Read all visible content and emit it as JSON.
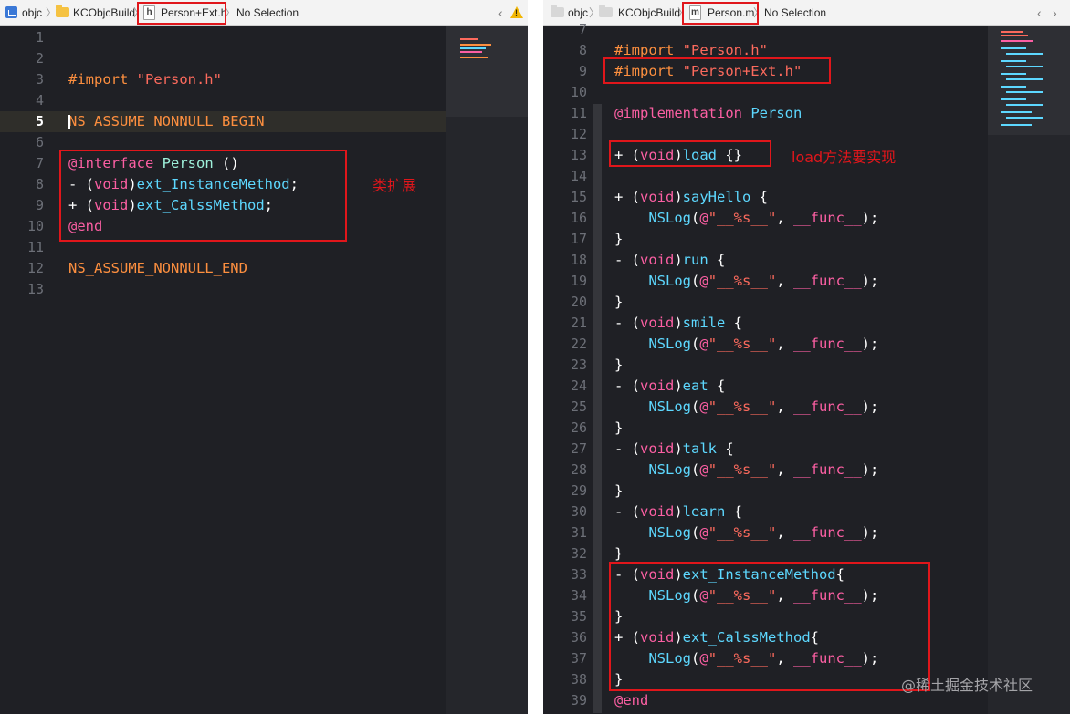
{
  "left_pane": {
    "breadcrumb": {
      "project": "objc",
      "group": "KCObjcBuild",
      "file_badge": "h",
      "file": "Person+Ext.h",
      "selection": "No Selection"
    },
    "current_line": 5,
    "lines": [
      {
        "n": "1",
        "tokens": []
      },
      {
        "n": "2",
        "tokens": []
      },
      {
        "n": "3",
        "tokens": [
          {
            "c": "t-pre",
            "t": "#import "
          },
          {
            "c": "t-str",
            "t": "\"Person.h\""
          }
        ]
      },
      {
        "n": "4",
        "tokens": []
      },
      {
        "n": "5",
        "tokens": [
          {
            "c": "t-macro",
            "t": "NS_ASSUME_NONNULL_BEGIN"
          }
        ]
      },
      {
        "n": "6",
        "tokens": []
      },
      {
        "n": "7",
        "tokens": [
          {
            "c": "t-kw",
            "t": "@interface "
          },
          {
            "c": "t-type",
            "t": "Person"
          },
          {
            "c": "t-pl",
            "t": " ()"
          }
        ]
      },
      {
        "n": "8",
        "tokens": [
          {
            "c": "t-pl",
            "t": "- ("
          },
          {
            "c": "t-kw",
            "t": "void"
          },
          {
            "c": "t-pl",
            "t": ")"
          },
          {
            "c": "t-cls",
            "t": "ext_InstanceMethod"
          },
          {
            "c": "t-pl",
            "t": ";"
          }
        ]
      },
      {
        "n": "9",
        "tokens": [
          {
            "c": "t-pl",
            "t": "+ ("
          },
          {
            "c": "t-kw",
            "t": "void"
          },
          {
            "c": "t-pl",
            "t": ")"
          },
          {
            "c": "t-cls",
            "t": "ext_CalssMethod"
          },
          {
            "c": "t-pl",
            "t": ";"
          }
        ]
      },
      {
        "n": "10",
        "tokens": [
          {
            "c": "t-kw",
            "t": "@end"
          }
        ]
      },
      {
        "n": "11",
        "tokens": []
      },
      {
        "n": "12",
        "tokens": [
          {
            "c": "t-macro",
            "t": "NS_ASSUME_NONNULL_END"
          }
        ]
      },
      {
        "n": "13",
        "tokens": []
      }
    ],
    "annotation": "类扩展"
  },
  "right_pane": {
    "breadcrumb": {
      "project": "objc",
      "group": "KCObjcBuild",
      "file_badge": "m",
      "file": "Person.m",
      "selection": "No Selection"
    },
    "lines": [
      {
        "n": "7",
        "tokens": []
      },
      {
        "n": "8",
        "tokens": [
          {
            "c": "t-pre",
            "t": "#import "
          },
          {
            "c": "t-str",
            "t": "\"Person.h\""
          }
        ]
      },
      {
        "n": "9",
        "tokens": [
          {
            "c": "t-pre",
            "t": "#import "
          },
          {
            "c": "t-str",
            "t": "\"Person+Ext.h\""
          }
        ]
      },
      {
        "n": "10",
        "tokens": []
      },
      {
        "n": "11",
        "tokens": [
          {
            "c": "t-kw",
            "t": "@implementation "
          },
          {
            "c": "t-cls",
            "t": "Person"
          }
        ]
      },
      {
        "n": "12",
        "tokens": []
      },
      {
        "n": "13",
        "tokens": [
          {
            "c": "t-pl",
            "t": "+ ("
          },
          {
            "c": "t-kw",
            "t": "void"
          },
          {
            "c": "t-pl",
            "t": ")"
          },
          {
            "c": "t-cls",
            "t": "load"
          },
          {
            "c": "t-pl",
            "t": " {}"
          }
        ]
      },
      {
        "n": "14",
        "tokens": []
      },
      {
        "n": "15",
        "tokens": [
          {
            "c": "t-pl",
            "t": "+ ("
          },
          {
            "c": "t-kw",
            "t": "void"
          },
          {
            "c": "t-pl",
            "t": ")"
          },
          {
            "c": "t-cls",
            "t": "sayHello"
          },
          {
            "c": "t-pl",
            "t": " {"
          }
        ]
      },
      {
        "n": "16",
        "tokens": [
          {
            "c": "t-pl",
            "t": "    "
          },
          {
            "c": "t-cls",
            "t": "NSLog"
          },
          {
            "c": "t-pl",
            "t": "("
          },
          {
            "c": "t-kw",
            "t": "@"
          },
          {
            "c": "t-str",
            "t": "\"__%s__\""
          },
          {
            "c": "t-pl",
            "t": ", "
          },
          {
            "c": "t-kw",
            "t": "__func__"
          },
          {
            "c": "t-pl",
            "t": ");"
          }
        ]
      },
      {
        "n": "17",
        "tokens": [
          {
            "c": "t-pl",
            "t": "}"
          }
        ]
      },
      {
        "n": "18",
        "tokens": [
          {
            "c": "t-pl",
            "t": "- ("
          },
          {
            "c": "t-kw",
            "t": "void"
          },
          {
            "c": "t-pl",
            "t": ")"
          },
          {
            "c": "t-cls",
            "t": "run"
          },
          {
            "c": "t-pl",
            "t": " {"
          }
        ]
      },
      {
        "n": "19",
        "tokens": [
          {
            "c": "t-pl",
            "t": "    "
          },
          {
            "c": "t-cls",
            "t": "NSLog"
          },
          {
            "c": "t-pl",
            "t": "("
          },
          {
            "c": "t-kw",
            "t": "@"
          },
          {
            "c": "t-str",
            "t": "\"__%s__\""
          },
          {
            "c": "t-pl",
            "t": ", "
          },
          {
            "c": "t-kw",
            "t": "__func__"
          },
          {
            "c": "t-pl",
            "t": ");"
          }
        ]
      },
      {
        "n": "20",
        "tokens": [
          {
            "c": "t-pl",
            "t": "}"
          }
        ]
      },
      {
        "n": "21",
        "tokens": [
          {
            "c": "t-pl",
            "t": "- ("
          },
          {
            "c": "t-kw",
            "t": "void"
          },
          {
            "c": "t-pl",
            "t": ")"
          },
          {
            "c": "t-cls",
            "t": "smile"
          },
          {
            "c": "t-pl",
            "t": " {"
          }
        ]
      },
      {
        "n": "22",
        "tokens": [
          {
            "c": "t-pl",
            "t": "    "
          },
          {
            "c": "t-cls",
            "t": "NSLog"
          },
          {
            "c": "t-pl",
            "t": "("
          },
          {
            "c": "t-kw",
            "t": "@"
          },
          {
            "c": "t-str",
            "t": "\"__%s__\""
          },
          {
            "c": "t-pl",
            "t": ", "
          },
          {
            "c": "t-kw",
            "t": "__func__"
          },
          {
            "c": "t-pl",
            "t": ");"
          }
        ]
      },
      {
        "n": "23",
        "tokens": [
          {
            "c": "t-pl",
            "t": "}"
          }
        ]
      },
      {
        "n": "24",
        "tokens": [
          {
            "c": "t-pl",
            "t": "- ("
          },
          {
            "c": "t-kw",
            "t": "void"
          },
          {
            "c": "t-pl",
            "t": ")"
          },
          {
            "c": "t-cls",
            "t": "eat"
          },
          {
            "c": "t-pl",
            "t": " {"
          }
        ]
      },
      {
        "n": "25",
        "tokens": [
          {
            "c": "t-pl",
            "t": "    "
          },
          {
            "c": "t-cls",
            "t": "NSLog"
          },
          {
            "c": "t-pl",
            "t": "("
          },
          {
            "c": "t-kw",
            "t": "@"
          },
          {
            "c": "t-str",
            "t": "\"__%s__\""
          },
          {
            "c": "t-pl",
            "t": ", "
          },
          {
            "c": "t-kw",
            "t": "__func__"
          },
          {
            "c": "t-pl",
            "t": ");"
          }
        ]
      },
      {
        "n": "26",
        "tokens": [
          {
            "c": "t-pl",
            "t": "}"
          }
        ]
      },
      {
        "n": "27",
        "tokens": [
          {
            "c": "t-pl",
            "t": "- ("
          },
          {
            "c": "t-kw",
            "t": "void"
          },
          {
            "c": "t-pl",
            "t": ")"
          },
          {
            "c": "t-cls",
            "t": "talk"
          },
          {
            "c": "t-pl",
            "t": " {"
          }
        ]
      },
      {
        "n": "28",
        "tokens": [
          {
            "c": "t-pl",
            "t": "    "
          },
          {
            "c": "t-cls",
            "t": "NSLog"
          },
          {
            "c": "t-pl",
            "t": "("
          },
          {
            "c": "t-kw",
            "t": "@"
          },
          {
            "c": "t-str",
            "t": "\"__%s__\""
          },
          {
            "c": "t-pl",
            "t": ", "
          },
          {
            "c": "t-kw",
            "t": "__func__"
          },
          {
            "c": "t-pl",
            "t": ");"
          }
        ]
      },
      {
        "n": "29",
        "tokens": [
          {
            "c": "t-pl",
            "t": "}"
          }
        ]
      },
      {
        "n": "30",
        "tokens": [
          {
            "c": "t-pl",
            "t": "- ("
          },
          {
            "c": "t-kw",
            "t": "void"
          },
          {
            "c": "t-pl",
            "t": ")"
          },
          {
            "c": "t-cls",
            "t": "learn"
          },
          {
            "c": "t-pl",
            "t": " {"
          }
        ]
      },
      {
        "n": "31",
        "tokens": [
          {
            "c": "t-pl",
            "t": "    "
          },
          {
            "c": "t-cls",
            "t": "NSLog"
          },
          {
            "c": "t-pl",
            "t": "("
          },
          {
            "c": "t-kw",
            "t": "@"
          },
          {
            "c": "t-str",
            "t": "\"__%s__\""
          },
          {
            "c": "t-pl",
            "t": ", "
          },
          {
            "c": "t-kw",
            "t": "__func__"
          },
          {
            "c": "t-pl",
            "t": ");"
          }
        ]
      },
      {
        "n": "32",
        "tokens": [
          {
            "c": "t-pl",
            "t": "}"
          }
        ]
      },
      {
        "n": "33",
        "tokens": [
          {
            "c": "t-pl",
            "t": "- ("
          },
          {
            "c": "t-kw",
            "t": "void"
          },
          {
            "c": "t-pl",
            "t": ")"
          },
          {
            "c": "t-cls",
            "t": "ext_InstanceMethod"
          },
          {
            "c": "t-pl",
            "t": "{"
          }
        ]
      },
      {
        "n": "34",
        "tokens": [
          {
            "c": "t-pl",
            "t": "    "
          },
          {
            "c": "t-cls",
            "t": "NSLog"
          },
          {
            "c": "t-pl",
            "t": "("
          },
          {
            "c": "t-kw",
            "t": "@"
          },
          {
            "c": "t-str",
            "t": "\"__%s__\""
          },
          {
            "c": "t-pl",
            "t": ", "
          },
          {
            "c": "t-kw",
            "t": "__func__"
          },
          {
            "c": "t-pl",
            "t": ");"
          }
        ]
      },
      {
        "n": "35",
        "tokens": [
          {
            "c": "t-pl",
            "t": "}"
          }
        ]
      },
      {
        "n": "36",
        "tokens": [
          {
            "c": "t-pl",
            "t": "+ ("
          },
          {
            "c": "t-kw",
            "t": "void"
          },
          {
            "c": "t-pl",
            "t": ")"
          },
          {
            "c": "t-cls",
            "t": "ext_CalssMethod"
          },
          {
            "c": "t-pl",
            "t": "{"
          }
        ]
      },
      {
        "n": "37",
        "tokens": [
          {
            "c": "t-pl",
            "t": "    "
          },
          {
            "c": "t-cls",
            "t": "NSLog"
          },
          {
            "c": "t-pl",
            "t": "("
          },
          {
            "c": "t-kw",
            "t": "@"
          },
          {
            "c": "t-str",
            "t": "\"__%s__\""
          },
          {
            "c": "t-pl",
            "t": ", "
          },
          {
            "c": "t-kw",
            "t": "__func__"
          },
          {
            "c": "t-pl",
            "t": ");"
          }
        ]
      },
      {
        "n": "38",
        "tokens": [
          {
            "c": "t-pl",
            "t": "}"
          }
        ]
      },
      {
        "n": "39",
        "tokens": [
          {
            "c": "t-kw",
            "t": "@end"
          }
        ]
      }
    ],
    "annotation": "load方法要实现"
  },
  "watermark": "@稀土掘金技术社区",
  "icons": {
    "project": "xcode-project-icon",
    "folder": "folder-icon",
    "file": "source-file-icon",
    "back": "chevron-left-icon",
    "forward": "chevron-right-icon",
    "warning": "warning-icon"
  },
  "colors": {
    "editor_bg": "#1f2025",
    "annotation": "#e0161b",
    "keyword": "#fc5fa3",
    "string": "#fc6a5d",
    "preprocessor": "#fd8f3f",
    "identifier": "#5dd8ff"
  }
}
